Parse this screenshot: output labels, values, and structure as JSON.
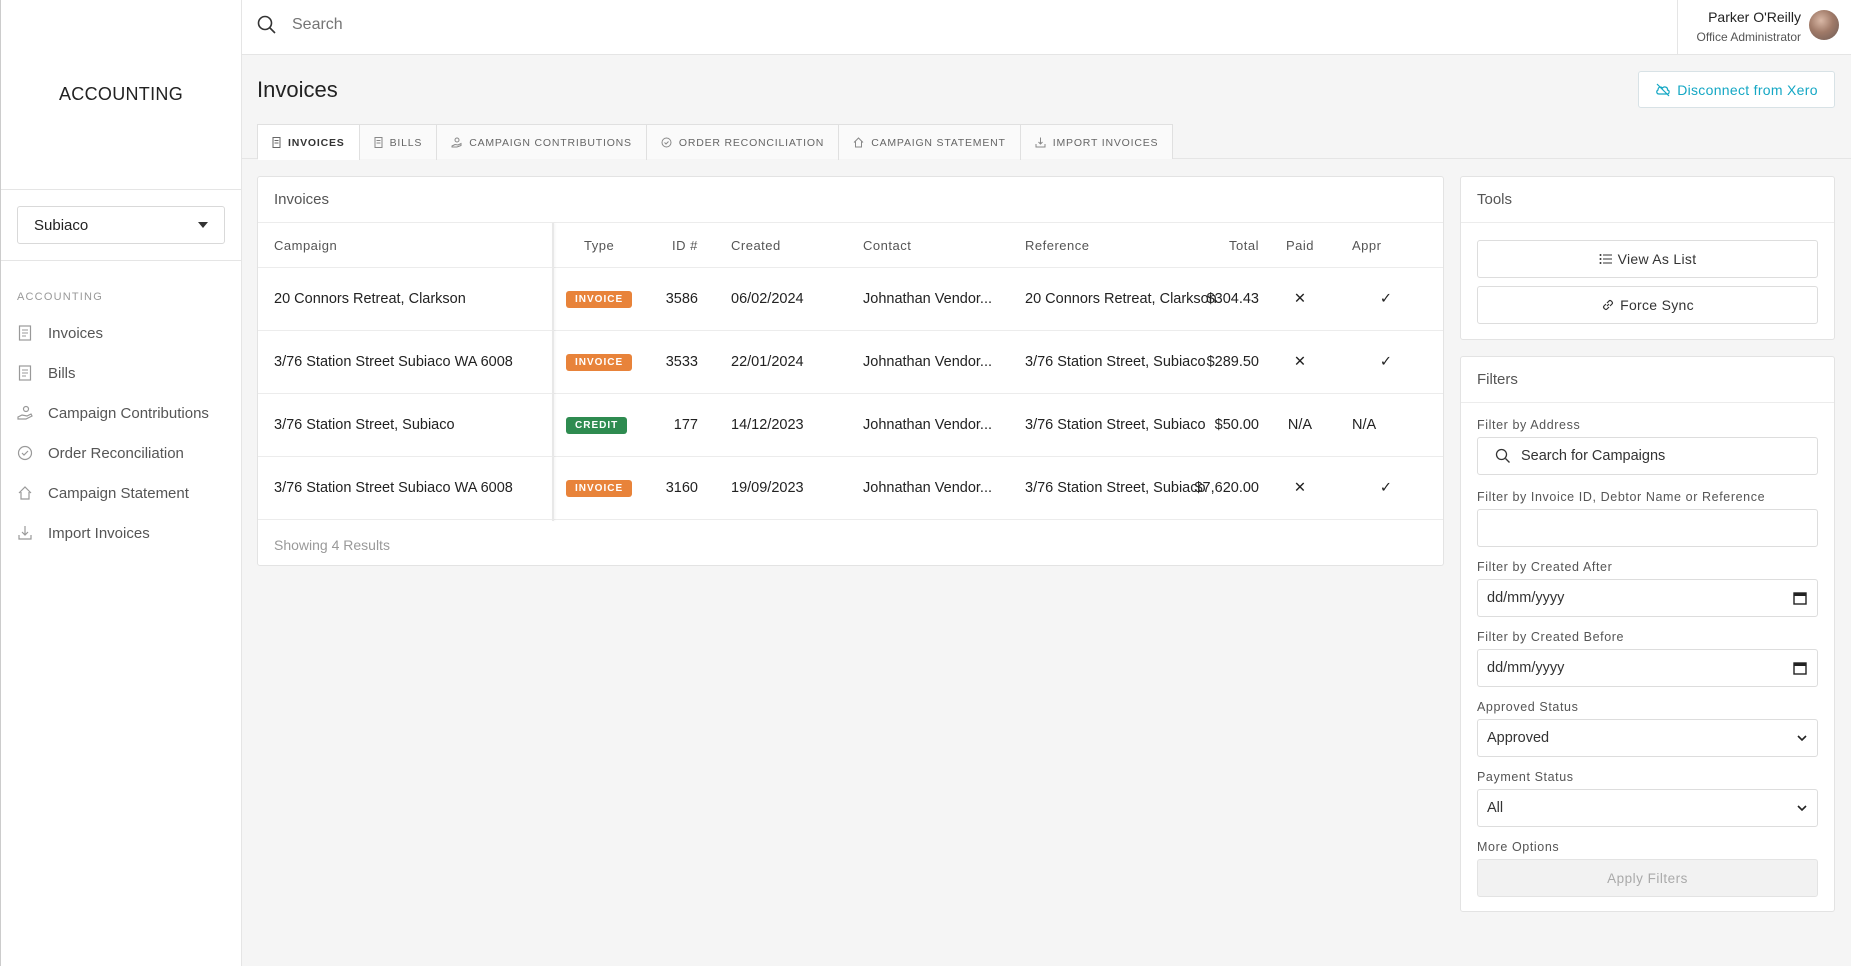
{
  "sidebar": {
    "brand": "ACCOUNTING",
    "site_select_value": "Subiaco",
    "section_label": "ACCOUNTING",
    "items": [
      {
        "label": "Invoices",
        "icon": "receipt-icon"
      },
      {
        "label": "Bills",
        "icon": "receipt-icon"
      },
      {
        "label": "Campaign Contributions",
        "icon": "hand-coins-icon"
      },
      {
        "label": "Order Reconciliation",
        "icon": "check-circle-icon"
      },
      {
        "label": "Campaign Statement",
        "icon": "home-icon"
      },
      {
        "label": "Import Invoices",
        "icon": "import-icon"
      }
    ]
  },
  "topbar": {
    "search_placeholder": "Search",
    "user_name": "Parker O'Reilly",
    "user_role": "Office Administrator"
  },
  "page": {
    "title": "Invoices",
    "disconnect_label": "Disconnect from Xero"
  },
  "tabs": [
    {
      "label": "INVOICES",
      "active": true
    },
    {
      "label": "BILLS",
      "active": false
    },
    {
      "label": "CAMPAIGN CONTRIBUTIONS",
      "active": false
    },
    {
      "label": "ORDER RECONCILIATION",
      "active": false
    },
    {
      "label": "CAMPAIGN STATEMENT",
      "active": false
    },
    {
      "label": "IMPORT INVOICES",
      "active": false
    }
  ],
  "invoices": {
    "card_title": "Invoices",
    "columns": [
      "Campaign",
      "Type",
      "ID #",
      "Created",
      "Contact",
      "Reference",
      "Total",
      "Paid",
      "Appr"
    ],
    "rows": [
      {
        "campaign": "20 Connors Retreat, Clarkson",
        "type": "INVOICE",
        "id": "3586",
        "created": "06/02/2024",
        "contact": "Johnathan Vendor...",
        "reference": "20 Connors Retreat, Clarkson",
        "total": "$304.43",
        "paid": "✕",
        "approved": "✓"
      },
      {
        "campaign": "3/76 Station Street Subiaco WA 6008",
        "type": "INVOICE",
        "id": "3533",
        "created": "22/01/2024",
        "contact": "Johnathan Vendor...",
        "reference": "3/76 Station Street, Subiaco",
        "total": "$289.50",
        "paid": "✕",
        "approved": "✓"
      },
      {
        "campaign": "3/76 Station Street, Subiaco",
        "type": "CREDIT",
        "id": "177",
        "created": "14/12/2023",
        "contact": "Johnathan Vendor...",
        "reference": "3/76 Station Street, Subiaco",
        "total": "$50.00",
        "paid": "N/A",
        "approved": "N/A"
      },
      {
        "campaign": "3/76 Station Street Subiaco WA 6008",
        "type": "INVOICE",
        "id": "3160",
        "created": "19/09/2023",
        "contact": "Johnathan Vendor...",
        "reference": "3/76 Station Street, Subiaco",
        "total": "$7,620.00",
        "paid": "✕",
        "approved": "✓"
      }
    ],
    "footer": "Showing 4 Results"
  },
  "tools": {
    "title": "Tools",
    "view_as_list": "View As List",
    "force_sync": "Force Sync"
  },
  "filters": {
    "title": "Filters",
    "address_label": "Filter by Address",
    "address_placeholder": "Search for Campaigns",
    "invoice_label": "Filter by Invoice ID, Debtor Name or Reference",
    "invoice_value": "",
    "created_after_label": "Filter by Created After",
    "created_after_value": "dd/mm/yyyy",
    "created_before_label": "Filter by Created Before",
    "created_before_value": "dd/mm/yyyy",
    "approved_label": "Approved Status",
    "approved_value": "Approved",
    "payment_label": "Payment Status",
    "payment_value": "All",
    "more_options_label": "More Options",
    "apply_label": "Apply Filters"
  },
  "colors": {
    "accent": "#14a7c4",
    "invoice_badge": "#e8833a",
    "credit_badge": "#2e8b50",
    "na_text": "#2e9b4f"
  }
}
